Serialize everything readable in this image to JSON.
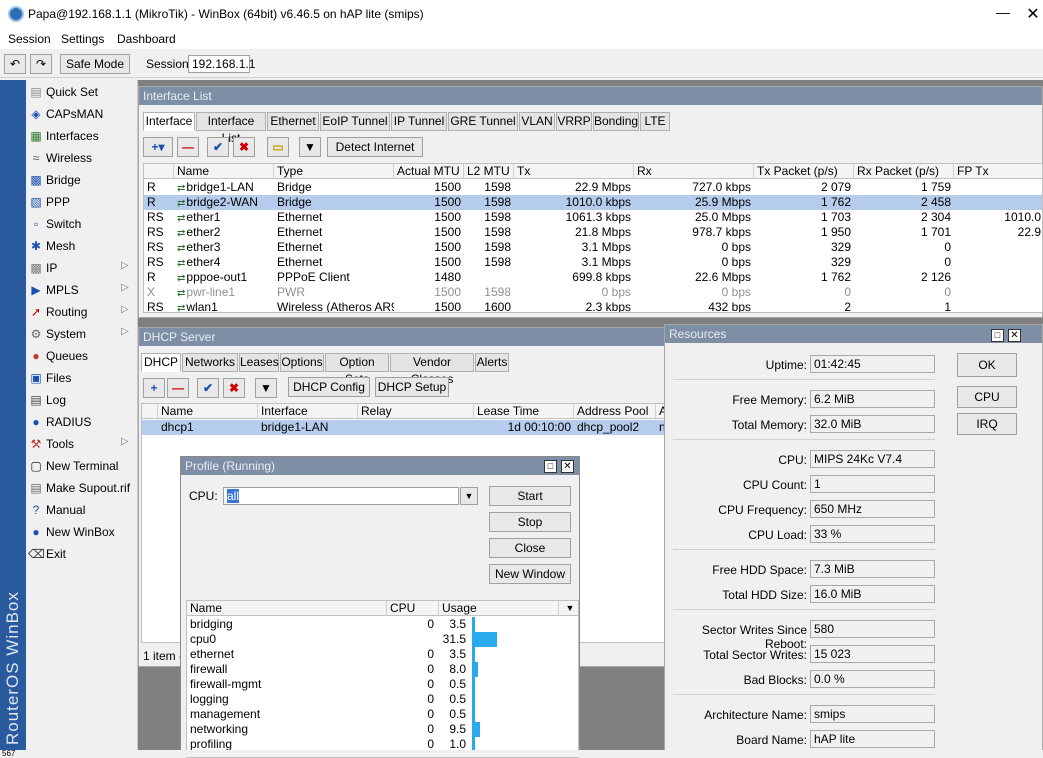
{
  "window_title": "Papa@192.168.1.1 (MikroTik) - WinBox (64bit) v6.46.5 on hAP lite (smips)",
  "menu": [
    "Session",
    "Settings",
    "Dashboard"
  ],
  "toolbar": {
    "safe_mode": "Safe Mode",
    "session_label": "Session:",
    "session_value": "192.168.1.1"
  },
  "brand": "RouterOS WinBox",
  "sidebar": [
    {
      "label": "Quick Set",
      "icon": "quickset-icon",
      "sub": false
    },
    {
      "label": "CAPsMAN",
      "icon": "capsman-icon",
      "sub": false
    },
    {
      "label": "Interfaces",
      "icon": "interfaces-icon",
      "sub": false
    },
    {
      "label": "Wireless",
      "icon": "wireless-icon",
      "sub": false
    },
    {
      "label": "Bridge",
      "icon": "bridge-icon",
      "sub": false
    },
    {
      "label": "PPP",
      "icon": "ppp-icon",
      "sub": false
    },
    {
      "label": "Switch",
      "icon": "switch-icon",
      "sub": false
    },
    {
      "label": "Mesh",
      "icon": "mesh-icon",
      "sub": false
    },
    {
      "label": "IP",
      "icon": "ip-icon",
      "sub": true
    },
    {
      "label": "MPLS",
      "icon": "mpls-icon",
      "sub": true
    },
    {
      "label": "Routing",
      "icon": "routing-icon",
      "sub": true
    },
    {
      "label": "System",
      "icon": "system-icon",
      "sub": true
    },
    {
      "label": "Queues",
      "icon": "queues-icon",
      "sub": false
    },
    {
      "label": "Files",
      "icon": "files-icon",
      "sub": false
    },
    {
      "label": "Log",
      "icon": "log-icon",
      "sub": false
    },
    {
      "label": "RADIUS",
      "icon": "radius-icon",
      "sub": false
    },
    {
      "label": "Tools",
      "icon": "tools-icon",
      "sub": true
    },
    {
      "label": "New Terminal",
      "icon": "terminal-icon",
      "sub": false
    },
    {
      "label": "Make Supout.rif",
      "icon": "supout-icon",
      "sub": false
    },
    {
      "label": "Manual",
      "icon": "manual-icon",
      "sub": false
    },
    {
      "label": "New WinBox",
      "icon": "winbox-icon",
      "sub": false
    },
    {
      "label": "Exit",
      "icon": "exit-icon",
      "sub": false
    }
  ],
  "interface_list": {
    "title": "Interface List",
    "tabs": [
      "Interface",
      "Interface List",
      "Ethernet",
      "EoIP Tunnel",
      "IP Tunnel",
      "GRE Tunnel",
      "VLAN",
      "VRRP",
      "Bonding",
      "LTE"
    ],
    "detect_button": "Detect Internet",
    "columns": [
      "",
      "Name",
      "Type",
      "Actual MTU",
      "L2 MTU",
      "Tx",
      "Rx",
      "Tx Packet (p/s)",
      "Rx Packet (p/s)",
      "FP Tx"
    ],
    "rows": [
      {
        "flag": "R",
        "name": "bridge1-LAN",
        "type": "Bridge",
        "mtu": "1500",
        "l2mtu": "1598",
        "tx": "22.9 Mbps",
        "rx": "727.0 kbps",
        "txp": "2 079",
        "rxp": "1 759",
        "fptx": ""
      },
      {
        "flag": "R",
        "name": "bridge2-WAN",
        "type": "Bridge",
        "mtu": "1500",
        "l2mtu": "1598",
        "tx": "1010.0 kbps",
        "rx": "25.9 Mbps",
        "txp": "1 762",
        "rxp": "2 458",
        "fptx": ""
      },
      {
        "flag": "RS",
        "name": "ether1",
        "type": "Ethernet",
        "mtu": "1500",
        "l2mtu": "1598",
        "tx": "1061.3 kbps",
        "rx": "25.0 Mbps",
        "txp": "1 703",
        "rxp": "2 304",
        "fptx": "1010.0"
      },
      {
        "flag": "RS",
        "name": "ether2",
        "type": "Ethernet",
        "mtu": "1500",
        "l2mtu": "1598",
        "tx": "21.8 Mbps",
        "rx": "978.7 kbps",
        "txp": "1 950",
        "rxp": "1 701",
        "fptx": "22.9"
      },
      {
        "flag": "RS",
        "name": "ether3",
        "type": "Ethernet",
        "mtu": "1500",
        "l2mtu": "1598",
        "tx": "3.1 Mbps",
        "rx": "0 bps",
        "txp": "329",
        "rxp": "0",
        "fptx": ""
      },
      {
        "flag": "RS",
        "name": "ether4",
        "type": "Ethernet",
        "mtu": "1500",
        "l2mtu": "1598",
        "tx": "3.1 Mbps",
        "rx": "0 bps",
        "txp": "329",
        "rxp": "0",
        "fptx": ""
      },
      {
        "flag": "R",
        "name": "pppoe-out1",
        "type": "PPPoE Client",
        "mtu": "1480",
        "l2mtu": "",
        "tx": "699.8 kbps",
        "rx": "22.6 Mbps",
        "txp": "1 762",
        "rxp": "2 126",
        "fptx": ""
      },
      {
        "flag": "X",
        "name": "pwr-line1",
        "type": "PWR",
        "mtu": "1500",
        "l2mtu": "1598",
        "tx": "0 bps",
        "rx": "0 bps",
        "txp": "0",
        "rxp": "0",
        "fptx": ""
      },
      {
        "flag": "RS",
        "name": "wlan1",
        "type": "Wireless (Atheros AR9...",
        "mtu": "1500",
        "l2mtu": "1600",
        "tx": "2.3 kbps",
        "rx": "432 bps",
        "txp": "2",
        "rxp": "1",
        "fptx": ""
      }
    ]
  },
  "dhcp": {
    "title": "DHCP Server",
    "tabs": [
      "DHCP",
      "Networks",
      "Leases",
      "Options",
      "Option Sets",
      "Vendor Classes",
      "Alerts"
    ],
    "config_button": "DHCP Config",
    "setup_button": "DHCP Setup",
    "columns": [
      "Name",
      "Interface",
      "Relay",
      "Lease Time",
      "Address Pool",
      "Ac"
    ],
    "rows": [
      {
        "name": "dhcp1",
        "interface": "bridge1-LAN",
        "relay": "",
        "lease": "1d 00:10:00",
        "pool": "dhcp_pool2",
        "ac": "no"
      }
    ],
    "status": "1 item (1"
  },
  "profile": {
    "title": "Profile (Running)",
    "cpu_label": "CPU:",
    "cpu_value": "all",
    "buttons": [
      "Start",
      "Stop",
      "Close",
      "New Window"
    ],
    "columns": [
      "Name",
      "CPU",
      "Usage"
    ],
    "rows": [
      {
        "name": "bridging",
        "cpu": "0",
        "usage": "3.5",
        "pct": 3.5
      },
      {
        "name": "cpu0",
        "cpu": "",
        "usage": "31.5",
        "pct": 31.5
      },
      {
        "name": "ethernet",
        "cpu": "0",
        "usage": "3.5",
        "pct": 3.5
      },
      {
        "name": "firewall",
        "cpu": "0",
        "usage": "8.0",
        "pct": 8.0
      },
      {
        "name": "firewall-mgmt",
        "cpu": "0",
        "usage": "0.5",
        "pct": 0.5
      },
      {
        "name": "logging",
        "cpu": "0",
        "usage": "0.5",
        "pct": 0.5
      },
      {
        "name": "management",
        "cpu": "0",
        "usage": "0.5",
        "pct": 0.5
      },
      {
        "name": "networking",
        "cpu": "0",
        "usage": "9.5",
        "pct": 9.5
      },
      {
        "name": "profiling",
        "cpu": "0",
        "usage": "1.0",
        "pct": 1.0
      }
    ]
  },
  "resources": {
    "title": "Resources",
    "buttons": [
      "OK",
      "CPU",
      "IRQ"
    ],
    "fields": [
      {
        "label": "Uptime:",
        "value": "01:42:45"
      },
      {
        "label": "Free Memory:",
        "value": "6.2 MiB"
      },
      {
        "label": "Total Memory:",
        "value": "32.0 MiB"
      },
      {
        "label": "CPU:",
        "value": "MIPS 24Kc V7.4"
      },
      {
        "label": "CPU Count:",
        "value": "1"
      },
      {
        "label": "CPU Frequency:",
        "value": "650 MHz"
      },
      {
        "label": "CPU Load:",
        "value": "33 %"
      },
      {
        "label": "Free HDD Space:",
        "value": "7.3 MiB"
      },
      {
        "label": "Total HDD Size:",
        "value": "16.0 MiB"
      },
      {
        "label": "Sector Writes Since Reboot:",
        "value": "580"
      },
      {
        "label": "Total Sector Writes:",
        "value": "15 023"
      },
      {
        "label": "Bad Blocks:",
        "value": "0.0 %"
      },
      {
        "label": "Architecture Name:",
        "value": "smips"
      },
      {
        "label": "Board Name:",
        "value": "hAP lite"
      }
    ]
  },
  "colors": {
    "brand_bar": "#2a5a9e",
    "panel_title": "#7e8ea5",
    "selection": "#b5ccec",
    "usage_bar": "#2aaaee"
  },
  "bottom_text": "567"
}
